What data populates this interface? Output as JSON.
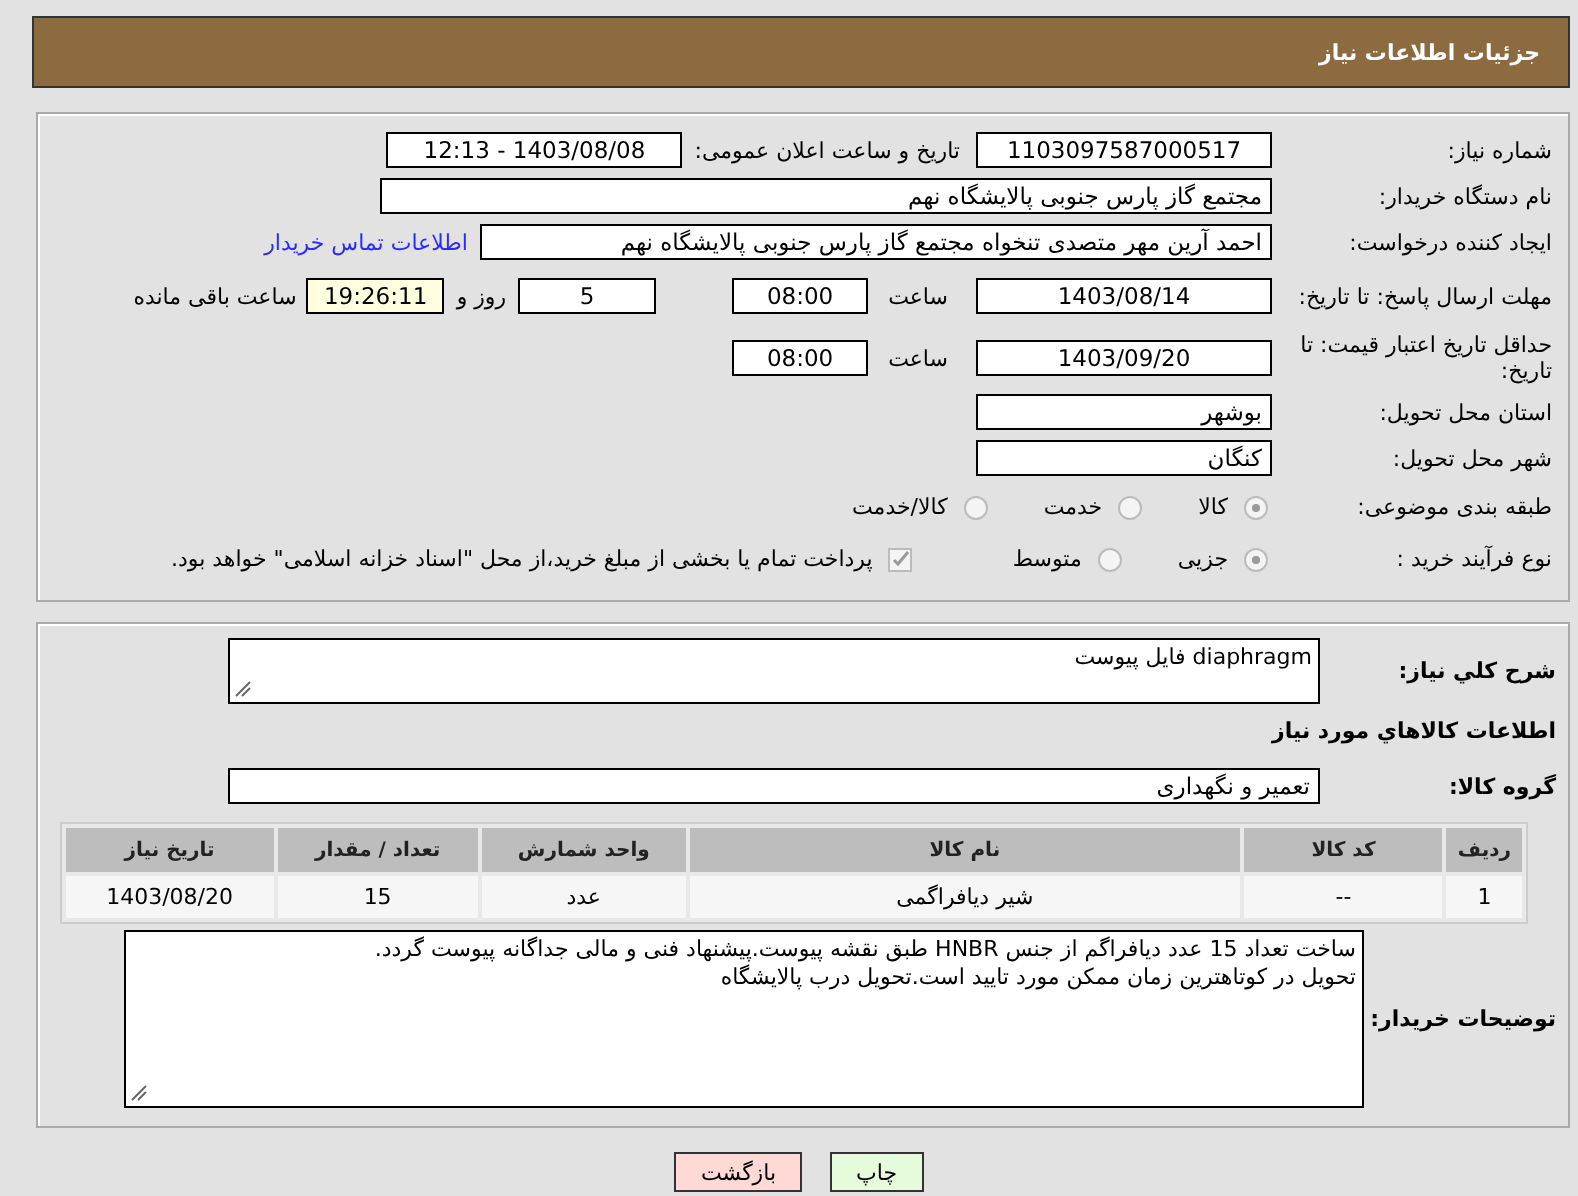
{
  "header": {
    "title": "جزئیات اطلاعات نیاز"
  },
  "need_number": {
    "label": "شماره نیاز:",
    "value": "1103097587000517"
  },
  "announce": {
    "label": "تاریخ و ساعت اعلان عمومی:",
    "value": "1403/08/08 - 12:13"
  },
  "buyer": {
    "label": "نام دستگاه خریدار:",
    "value": "مجتمع گاز پارس جنوبی  پالایشگاه نهم"
  },
  "requester": {
    "label": "ایجاد کننده درخواست:",
    "value": "احمد آرین مهر متصدی تنخواه مجتمع گاز پارس جنوبی  پالایشگاه نهم",
    "link": "اطلاعات تماس خریدار"
  },
  "reply_deadline": {
    "label": "مهلت ارسال پاسخ: تا تاریخ:",
    "date": "1403/08/14",
    "time_label": "ساعت",
    "time": "08:00",
    "days": "5",
    "days_label": "روز و",
    "remaining": "19:26:11",
    "remaining_label": "ساعت باقی مانده"
  },
  "price_validity": {
    "label": "حداقل تاریخ اعتبار قیمت: تا تاریخ:",
    "date": "1403/09/20",
    "time_label": "ساعت",
    "time": "08:00"
  },
  "province": {
    "label": "استان محل تحویل:",
    "value": "بوشهر"
  },
  "city": {
    "label": "شهر محل تحویل:",
    "value": "کنگان"
  },
  "category": {
    "label": "طبقه بندی موضوعی:",
    "options": [
      {
        "label": "کالا",
        "selected": true
      },
      {
        "label": "خدمت",
        "selected": false
      },
      {
        "label": "کالا/خدمت",
        "selected": false
      }
    ]
  },
  "process": {
    "label": "نوع فرآیند خرید :",
    "options": [
      {
        "label": "جزیی",
        "selected": true
      },
      {
        "label": "متوسط",
        "selected": false
      }
    ],
    "payment": {
      "label": "پرداخت تمام یا بخشی از مبلغ خرید،از محل \"اسناد خزانه اسلامی\" خواهد بود.",
      "checked": true
    }
  },
  "summary": {
    "label": "شرح کلي نياز:",
    "value": "diaphragm فایل پیوست"
  },
  "goods_heading": "اطلاعات كالاهاي مورد نياز",
  "goods_group": {
    "label": "گروه کالا:",
    "value": "تعمیر و نگهداری"
  },
  "table": {
    "columns": [
      "ردیف",
      "کد کالا",
      "نام کالا",
      "واحد شمارش",
      "تعداد / مقدار",
      "تاریخ نیاز"
    ],
    "rows": [
      [
        "1",
        "--",
        "شیر دیافراگمی",
        "عدد",
        "15",
        "1403/08/20"
      ]
    ]
  },
  "buyer_notes": {
    "label": "توضیحات خریدار:",
    "lines": [
      "ساخت تعداد 15 عدد دیافراگم از جنس HNBR طبق نقشه پیوست.پیشنهاد فنی و مالی جداگانه پیوست گردد.",
      "تحویل در کوتاهترین زمان ممکن مورد تایید است.تحویل درب پالایشگاه"
    ]
  },
  "buttons": [
    {
      "label": "چاپ",
      "kind": "print"
    },
    {
      "label": "بازگشت",
      "kind": "back"
    }
  ]
}
